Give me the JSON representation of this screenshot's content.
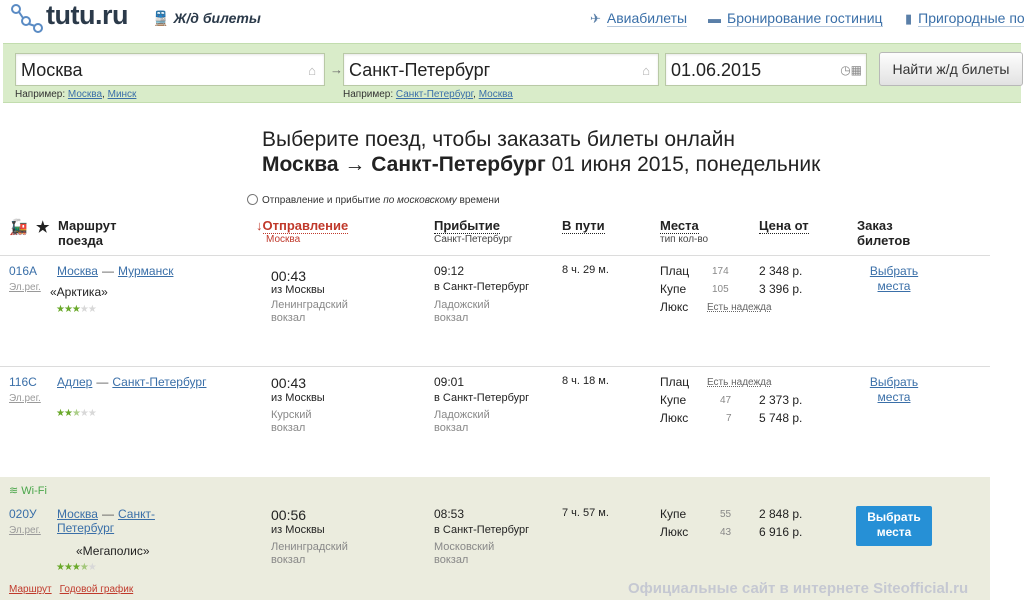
{
  "header": {
    "logo": "tutu.ru",
    "section": "Ж/д билеты",
    "nav": [
      {
        "label": "Авиабилеты",
        "icon": "plane-icon"
      },
      {
        "label": "Бронирование гостиниц",
        "icon": "bed-icon"
      },
      {
        "label": "Пригородные по",
        "icon": "train-icon"
      }
    ]
  },
  "search": {
    "from": "Москва",
    "to": "Санкт-Петербург",
    "date": "01.06.2015",
    "find_label": "Найти ж/д билеты",
    "hint_prefix": "Например:",
    "from_examples": [
      "Москва",
      "Минск"
    ],
    "to_examples": [
      "Санкт-Петербург",
      "Москва"
    ]
  },
  "heading": {
    "line1": "Выберите поезд, чтобы заказать билеты онлайн",
    "route": "Москва → Санкт-Петербург",
    "date": "01 июня 2015, понедельник",
    "tz_note_start": "Отправление и прибытие",
    "tz_note_em": "по московскому",
    "tz_note_end": "времени"
  },
  "columns": {
    "route": "Маршрут",
    "route2": "поезда",
    "departure": "Отправление",
    "departure_sub": "Москва",
    "arrival": "Прибытие",
    "arrival_sub": "Санкт-Петербург",
    "duration": "В пути",
    "seats": "Места",
    "seats_sub": "тип кол-во",
    "price": "Цена от",
    "order": "Заказ",
    "order2": "билетов"
  },
  "trains": [
    {
      "num": "016А",
      "kind": "Эл.рег.",
      "from": "Москва",
      "to": "Мурманск",
      "name": "«Арктика»",
      "rating": 3,
      "dep_time": "00:43",
      "dep_from": "из Москвы",
      "dep_station": "Ленинградский",
      "dep_station2": "вокзал",
      "arr_time": "09:12",
      "arr_to": "в Санкт-Петербург",
      "arr_station": "Ладожский",
      "arr_station2": "вокзал",
      "duration": "8 ч. 29 м.",
      "seats": [
        {
          "type": "Плац",
          "count": "174",
          "price": "2 348 р."
        },
        {
          "type": "Купе",
          "count": "105",
          "price": "3 396 р."
        },
        {
          "type": "Люкс",
          "hope": "Есть надежда",
          "price": ""
        }
      ],
      "choose1": "Выбрать",
      "choose2": "места"
    },
    {
      "num": "116С",
      "kind": "Эл.рег.",
      "from": "Адлер",
      "to": "Санкт-Петербург",
      "name": "",
      "rating": 2.5,
      "dep_time": "00:43",
      "dep_from": "из Москвы",
      "dep_station": "Курский",
      "dep_station2": "вокзал",
      "arr_time": "09:01",
      "arr_to": "в Санкт-Петербург",
      "arr_station": "Ладожский",
      "arr_station2": "вокзал",
      "duration": "8 ч. 18 м.",
      "seats": [
        {
          "type": "Плац",
          "hope": "Есть надежда",
          "price": ""
        },
        {
          "type": "Купе",
          "count": "47",
          "price": "2 373 р."
        },
        {
          "type": "Люкс",
          "count": "7",
          "price": "5 748 р."
        }
      ],
      "choose1": "Выбрать",
      "choose2": "места"
    },
    {
      "num": "020У",
      "kind": "Эл.рег.",
      "from": "Москва",
      "to": "Санкт-",
      "to2": "Петербург",
      "name": "«Мегаполис»",
      "rating": 3.5,
      "wifi": "Wi-Fi",
      "dep_time": "00:56",
      "dep_from": "из Москвы",
      "dep_station": "Ленинградский",
      "dep_station2": "вокзал",
      "arr_time": "08:53",
      "arr_to": "в Санкт-Петербург",
      "arr_station": "Московский",
      "arr_station2": "вокзал",
      "duration": "7 ч. 57 м.",
      "seats": [
        {
          "type": "Купе",
          "count": "55",
          "price": "2 848 р."
        },
        {
          "type": "Люкс",
          "count": "43",
          "price": "6 916 р."
        }
      ],
      "choose1": "Выбрать",
      "choose2": "места",
      "links": [
        "Маршрут",
        "Годовой график"
      ]
    }
  ],
  "watermark": "Официальные сайт в интернете Siteofficial.ru"
}
